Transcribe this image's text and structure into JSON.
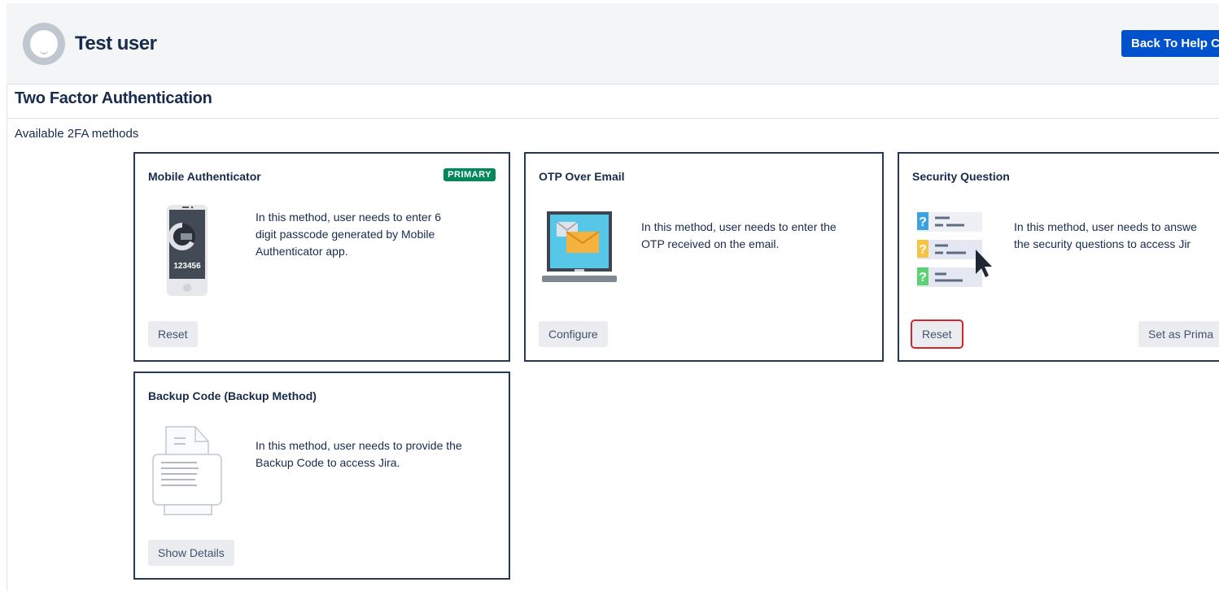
{
  "header": {
    "user_name": "Test user",
    "back_button": "Back To Help C"
  },
  "section": {
    "title": "Two Factor Authentication",
    "subtitle": "Available 2FA methods"
  },
  "methods": [
    {
      "title": "Mobile Authenticator",
      "badge": "PRIMARY",
      "description": [
        "In this method, user needs to enter 6",
        "digit passcode generated by Mobile",
        "Authenticator app."
      ],
      "illustration_text": "123456",
      "button": "Reset"
    },
    {
      "title": "OTP Over Email",
      "description": [
        "In this method, user needs to enter the",
        "OTP received on the email."
      ],
      "button": "Configure"
    },
    {
      "title": "Security Question",
      "description": [
        "In this method, user needs to answe",
        "the security questions to access Jir"
      ],
      "button": "Reset",
      "secondary_button": "Set as Prima"
    },
    {
      "title": "Backup Code (Backup Method)",
      "description": [
        "In this method, user needs to provide the",
        "Backup Code to access Jira."
      ],
      "button": "Show Details"
    }
  ],
  "colors": {
    "primary_badge": "#00875a",
    "accent_button": "#0052cc",
    "highlight_outline": "#d0262c",
    "card_border": "#253858"
  },
  "icons": {
    "avatar": "user-avatar-icon",
    "mobile": "mobile-phone-icon",
    "email": "laptop-email-icon",
    "security": "security-question-icon",
    "backup": "backup-document-icon"
  }
}
